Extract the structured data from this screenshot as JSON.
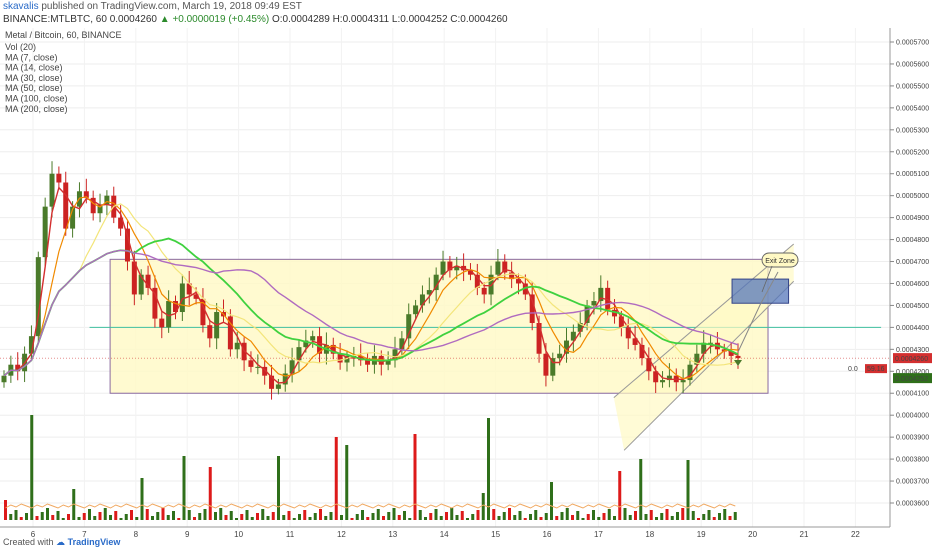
{
  "header": {
    "user": "skavalis",
    "published_text": "published on TradingView.com, March 19, 2018 09:49 EST",
    "symbol": "BINANCE:MTLBTC, 60",
    "last": "0.0004260",
    "change": "▲ +0.0000019 (+0.45%)",
    "open": "O:0.0004289",
    "high": "H:0.0004311",
    "low": "L:0.0004252",
    "close": "C:0.0004260"
  },
  "legend": {
    "title": "Metal / Bitcoin, 60, BINANCE",
    "items": [
      "Vol (20)",
      "MA (7, close)",
      "MA (14, close)",
      "MA (30, close)",
      "MA (50, close)",
      "MA (100, close)",
      "MA (200, close)"
    ]
  },
  "footer": {
    "created_with": "Created with",
    "brand": "TradingView"
  },
  "annotation": {
    "exit_zone": "Exit Zone"
  },
  "price_labels": {
    "last": "0.0004260",
    "bid_fragment": "0.0",
    "side": "59.16",
    "low": "0.0004252"
  },
  "colors": {
    "up": "#4a7a2a",
    "down": "#cc2222",
    "vol_up": "#2f6f1a",
    "vol_down": "#dd1a1a",
    "ma7": "#d32f2f",
    "ma14": "#f08a00",
    "ma30": "#f3e57a",
    "ma50": "#3fd13f",
    "ma100": "#b06bc0",
    "ma200": "#7b3c6e",
    "range_fill": "#fff9c4",
    "target_box": "#5577bb"
  },
  "chart_data": {
    "type": "candlestick",
    "pair": "MTL/BTC",
    "interval_minutes": 60,
    "y_ticks": [
      "0.0005700",
      "0.0005600",
      "0.0005500",
      "0.0005400",
      "0.0005300",
      "0.0005200",
      "0.0005100",
      "0.0005000",
      "0.0004900",
      "0.0004800",
      "0.0004700",
      "0.0004600",
      "0.0004500",
      "0.0004400",
      "0.0004300",
      "0.0004200",
      "0.0004100",
      "0.0004000",
      "0.0003900",
      "0.0003800",
      "0.0003700",
      "0.0003600"
    ],
    "x_ticks": [
      "6",
      "7",
      "8",
      "9",
      "10",
      "11",
      "12",
      "13",
      "14",
      "15",
      "16",
      "17",
      "18",
      "19",
      "20",
      "21",
      "22"
    ],
    "ranges": [
      {
        "label": "range",
        "top": 0.000471,
        "bottom": 0.00041,
        "from": 7.5,
        "to": 20.3
      }
    ],
    "lines": [
      {
        "label": "horizontal",
        "y": 0.00044,
        "from": 7.1,
        "to": 22.5
      }
    ],
    "channel": {
      "lower": [
        [
          17.5,
          0.000384
        ],
        [
          20.8,
          0.000461
        ]
      ],
      "upper": [
        [
          17.3,
          0.000408
        ],
        [
          20.8,
          0.000478
        ]
      ]
    },
    "target_zone": {
      "from": 19.6,
      "to": 20.7,
      "top": 0.000462,
      "bottom": 0.000451
    },
    "closes": [
      4.18,
      4.23,
      4.2,
      4.28,
      4.36,
      4.72,
      4.95,
      5.1,
      5.06,
      4.85,
      4.95,
      5.02,
      4.99,
      4.92,
      4.96,
      5.0,
      4.9,
      4.85,
      4.7,
      4.55,
      4.64,
      4.58,
      4.44,
      4.4,
      4.52,
      4.47,
      4.6,
      4.55,
      4.53,
      4.41,
      4.35,
      4.47,
      4.45,
      4.3,
      4.33,
      4.25,
      4.22,
      4.22,
      4.18,
      4.12,
      4.14,
      4.19,
      4.25,
      4.31,
      4.34,
      4.36,
      4.28,
      4.32,
      4.28,
      4.24,
      4.27,
      4.27,
      4.25,
      4.23,
      4.27,
      4.23,
      4.25,
      4.3,
      4.35,
      4.46,
      4.5,
      4.55,
      4.57,
      4.64,
      4.7,
      4.66,
      4.68,
      4.66,
      4.64,
      4.58,
      4.55,
      4.64,
      4.7,
      4.65,
      4.62,
      4.6,
      4.55,
      4.42,
      4.28,
      4.18,
      4.26,
      4.28,
      4.34,
      4.38,
      4.42,
      4.5,
      4.52,
      4.58,
      4.48,
      4.45,
      4.4,
      4.35,
      4.32,
      4.26,
      4.2,
      4.15,
      4.16,
      4.18,
      4.15,
      4.16,
      4.23,
      4.28,
      4.33,
      4.33,
      4.3,
      4.29,
      4.27,
      4.26
    ]
  }
}
